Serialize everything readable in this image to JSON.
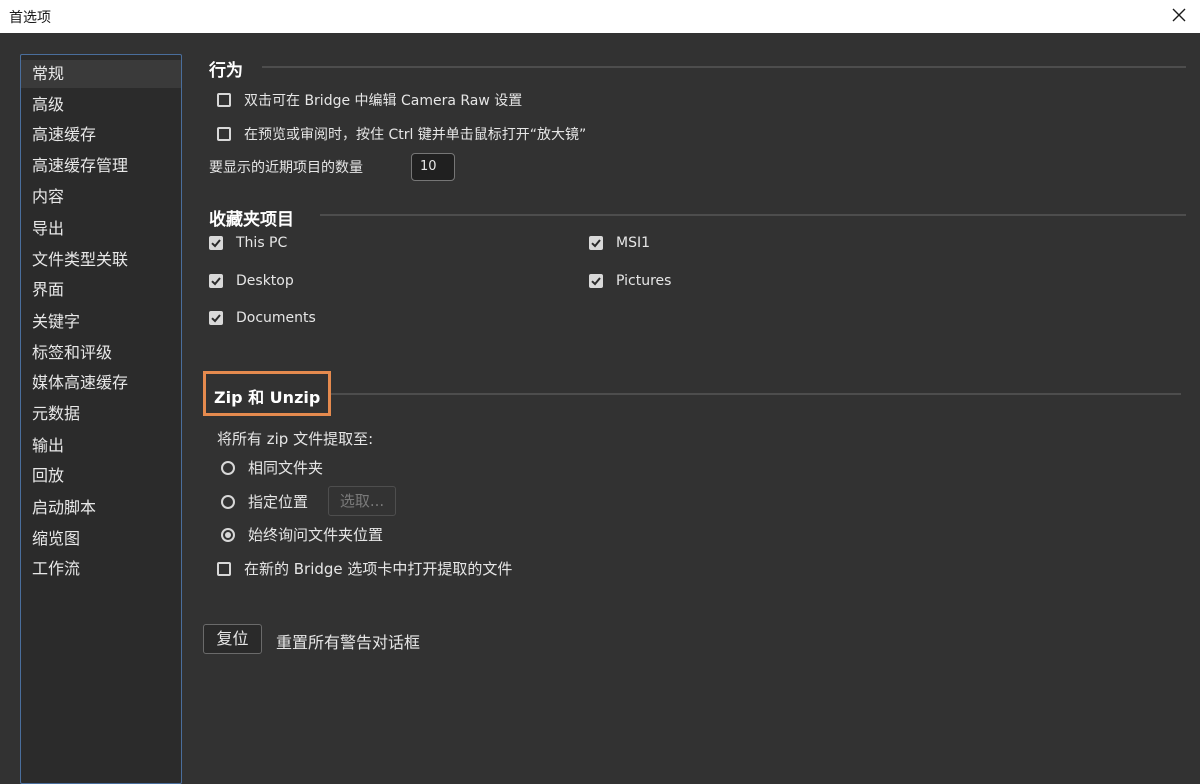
{
  "window": {
    "title": "首选项"
  },
  "sidebar": {
    "items": [
      {
        "label": "常规",
        "selected": true
      },
      {
        "label": "高级"
      },
      {
        "label": "高速缓存"
      },
      {
        "label": "高速缓存管理"
      },
      {
        "label": "内容"
      },
      {
        "label": "导出"
      },
      {
        "label": "文件类型关联"
      },
      {
        "label": "界面"
      },
      {
        "label": "关键字"
      },
      {
        "label": "标签和评级"
      },
      {
        "label": "媒体高速缓存"
      },
      {
        "label": "元数据"
      },
      {
        "label": "输出"
      },
      {
        "label": "回放"
      },
      {
        "label": "启动脚本"
      },
      {
        "label": "缩览图"
      },
      {
        "label": "工作流"
      }
    ]
  },
  "behavior": {
    "title": "行为",
    "double_click_label": "双击可在 Bridge 中编辑 Camera Raw 设置",
    "double_click_checked": false,
    "loupe_label": "在预览或审阅时，按住 Ctrl 键并单击鼠标打开“放大镜”",
    "loupe_checked": false,
    "recent_label": "要显示的近期项目的数量",
    "recent_value": "10"
  },
  "favorites": {
    "title": "收藏夹项目",
    "items": [
      {
        "label": "This PC",
        "checked": true
      },
      {
        "label": "MSI1",
        "checked": true
      },
      {
        "label": "Desktop",
        "checked": true
      },
      {
        "label": "Pictures",
        "checked": true
      },
      {
        "label": "Documents",
        "checked": true
      }
    ]
  },
  "zip": {
    "title": "Zip 和 Unzip",
    "extract_label": "将所有 zip 文件提取至:",
    "options": [
      {
        "label": "相同文件夹",
        "selected": false
      },
      {
        "label": "指定位置",
        "selected": false
      },
      {
        "label": "始终询问文件夹位置",
        "selected": true
      }
    ],
    "choose_button": "选取...",
    "new_tab_label": "在新的 Bridge 选项卡中打开提取的文件",
    "new_tab_checked": false
  },
  "reset": {
    "button": "复位",
    "label": "重置所有警告对话框"
  },
  "colors": {
    "background": "#323232",
    "sidebar_border": "#4a6e9c",
    "highlight": "#e58a4e"
  }
}
